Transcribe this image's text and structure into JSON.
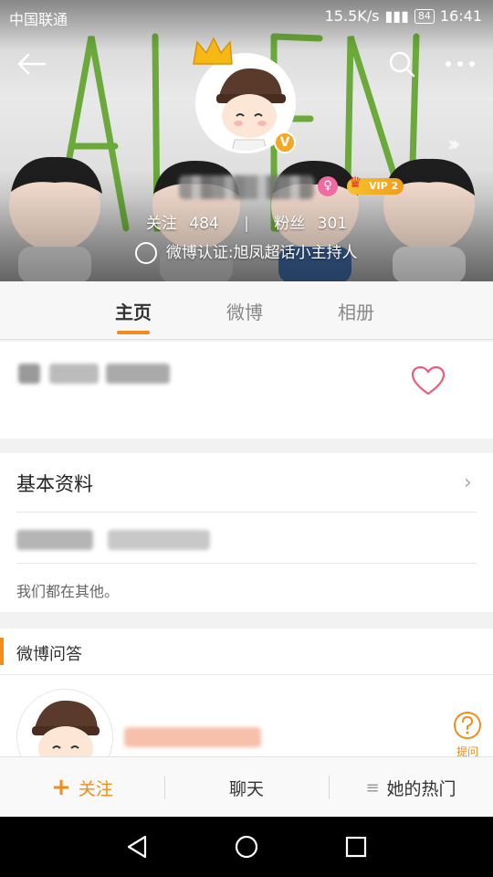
{
  "status_bar": {
    "carrier": "中国联通",
    "network_speed": "15.5K/s",
    "battery": "84",
    "time": "16:41"
  },
  "profile": {
    "vip_label": "VIP 2",
    "stats": {
      "following_label": "关注",
      "following_count": "484",
      "followers_label": "粉丝",
      "followers_count": "301"
    },
    "verification": "微博认证:旭凤超话小主持人"
  },
  "tabs": [
    {
      "label": "主页",
      "active": true
    },
    {
      "label": "微博",
      "active": false
    },
    {
      "label": "相册",
      "active": false
    }
  ],
  "basic_info": {
    "title": "基本资料",
    "motto": "我们都在其他。"
  },
  "qa": {
    "title": "微博问答",
    "ask_label": "提问"
  },
  "actions": {
    "follow": "关注",
    "chat": "聊天",
    "hot": "她的热门"
  },
  "colors": {
    "accent": "#f28c1a",
    "verified": "#f5a623",
    "heart": "#f05b7b"
  }
}
